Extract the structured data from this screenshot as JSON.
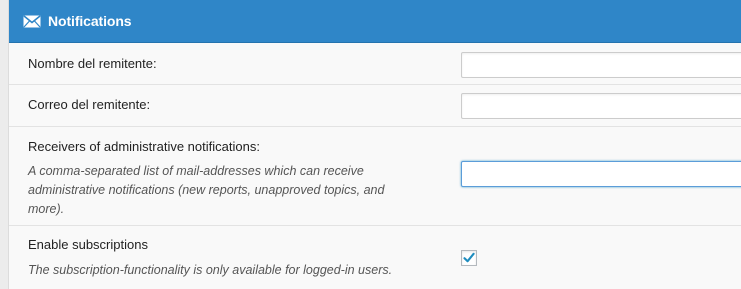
{
  "header": {
    "title": "Notifications",
    "icon": "envelope-icon",
    "color": "#2f86c8"
  },
  "fields": {
    "sender_name": {
      "label": "Nombre del remitente:",
      "value": ""
    },
    "sender_email": {
      "label": "Correo del remitente:",
      "value": ""
    },
    "admin_receivers": {
      "label": "Receivers of administrative notifications:",
      "description": "A comma-separated list of mail-addresses which can receive administrative notifications (new reports, unapproved topics, and more).",
      "value": ""
    },
    "subscriptions": {
      "label": "Enable subscriptions",
      "description": "The subscription-functionality is only available for logged-in users.",
      "checked": true,
      "check_icon": "checkmark-icon"
    }
  }
}
